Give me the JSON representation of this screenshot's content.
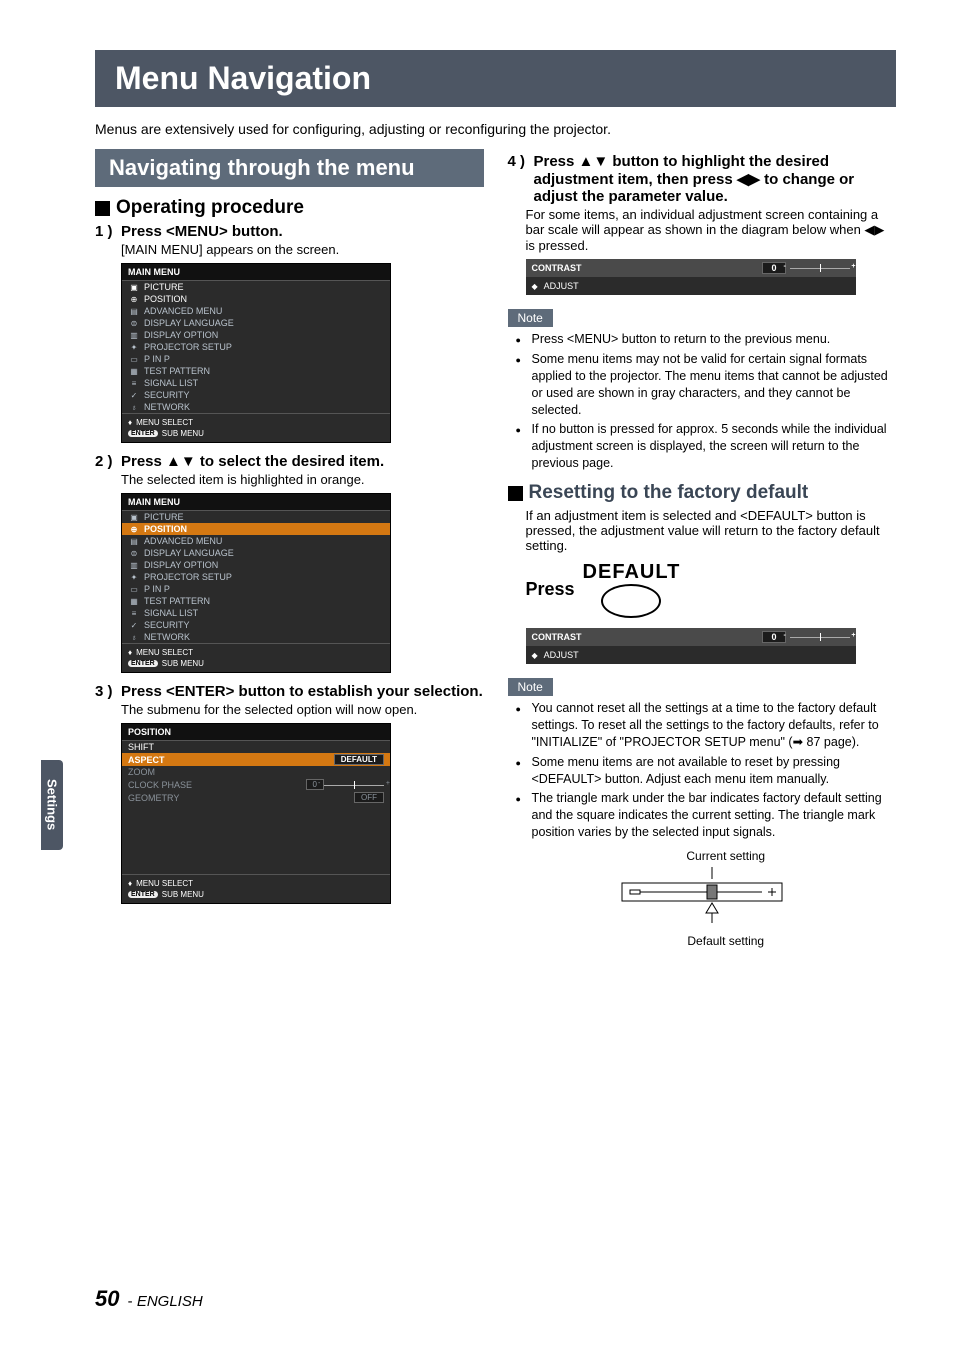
{
  "page_title": "Menu Navigation",
  "intro": "Menus are extensively used for configuring, adjusting or reconfiguring the projector.",
  "section_header": "Navigating through the menu",
  "operating_heading": "Operating procedure",
  "steps": {
    "s1_num": "1 )",
    "s1": "Press <MENU> button.",
    "s1_desc": "[MAIN MENU] appears on the screen.",
    "s2_num": "2 )",
    "s2": "Press ▲▼ to select the desired item.",
    "s2_desc": "The selected item is highlighted in orange.",
    "s3_num": "3 )",
    "s3": "Press <ENTER> button to establish your selection.",
    "s3_desc": "The submenu for the selected option will now open.",
    "s4_num": "4 )",
    "s4": "Press ▲▼ button to highlight the desired adjustment item, then press ◀▶ to change or adjust the parameter value.",
    "s4_desc": "For some items, an individual adjustment screen containing a bar scale will appear as shown in the diagram below when ◀▶ is pressed."
  },
  "main_menu_title": "MAIN MENU",
  "main_menu_items": [
    {
      "label": "PICTURE",
      "icon": "▣"
    },
    {
      "label": "POSITION",
      "icon": "⊕"
    },
    {
      "label": "ADVANCED MENU",
      "icon": "▤"
    },
    {
      "label": "DISPLAY LANGUAGE",
      "icon": "⊜"
    },
    {
      "label": "DISPLAY OPTION",
      "icon": "▥"
    },
    {
      "label": "PROJECTOR SETUP",
      "icon": "✦"
    },
    {
      "label": "P IN P",
      "icon": "▭"
    },
    {
      "label": "TEST PATTERN",
      "icon": "▦"
    },
    {
      "label": "SIGNAL LIST",
      "icon": "≡"
    },
    {
      "label": "SECURITY",
      "icon": "✓"
    },
    {
      "label": "NETWORK",
      "icon": "♁"
    }
  ],
  "menu_footer": {
    "select": "MENU SELECT",
    "select_icon": "♦",
    "enter_badge": "ENTER",
    "sub": "SUB MENU"
  },
  "position_menu": {
    "title": "POSITION",
    "items": [
      {
        "label": "SHIFT",
        "value": "",
        "sel": false,
        "dim": false
      },
      {
        "label": "ASPECT",
        "value": "DEFAULT",
        "sel": true,
        "dim": false
      },
      {
        "label": "ZOOM",
        "value": "",
        "sel": false,
        "dim": true
      },
      {
        "label": "CLOCK PHASE",
        "value": "0",
        "slider": true,
        "sel": false,
        "dim": true
      },
      {
        "label": "GEOMETRY",
        "value": "OFF",
        "sel": false,
        "dim": true
      }
    ]
  },
  "contrast_box": {
    "title": "CONTRAST",
    "value": "0",
    "adjust_label": "ADJUST"
  },
  "note_label": "Note",
  "notes1": [
    "Press <MENU> button to return to the previous menu.",
    "Some menu items may not be valid for certain signal formats applied to the projector. The menu items that cannot be adjusted or used are shown in gray characters, and they cannot be selected.",
    "If no button is pressed for approx. 5 seconds while the individual adjustment screen is displayed, the screen will return to the previous page."
  ],
  "reset_heading": "Resetting to the factory default",
  "reset_desc": "If an adjustment item is selected and <DEFAULT> button is pressed, the adjustment value will return to the factory default setting.",
  "default_btn": {
    "press": "Press",
    "label": "DEFAULT"
  },
  "notes2": [
    "You cannot reset all the settings at a time to the factory default settings. To reset all the settings to the factory defaults, refer to \"INITIALIZE\" of \"PROJECTOR SETUP menu\" (➡ 87 page).",
    "Some menu items are not available to reset by pressing <DEFAULT> button. Adjust each menu item manually.",
    "The triangle mark under the bar indicates factory default setting and the square indicates the current setting. The triangle mark position varies by the selected input signals."
  ],
  "diagram_labels": {
    "current": "Current setting",
    "default": "Default setting"
  },
  "side_tab": "Settings",
  "footer": {
    "page": "50",
    "sep": " - ",
    "lang": "ENGLISH"
  },
  "chart_data": {
    "type": "bar",
    "title": "Adjustment bar indicator",
    "series": [
      {
        "name": "Current setting",
        "marker": "square",
        "position": 0.55
      },
      {
        "name": "Default setting",
        "marker": "triangle",
        "position": 0.55
      }
    ],
    "range": [
      -1,
      1
    ]
  }
}
